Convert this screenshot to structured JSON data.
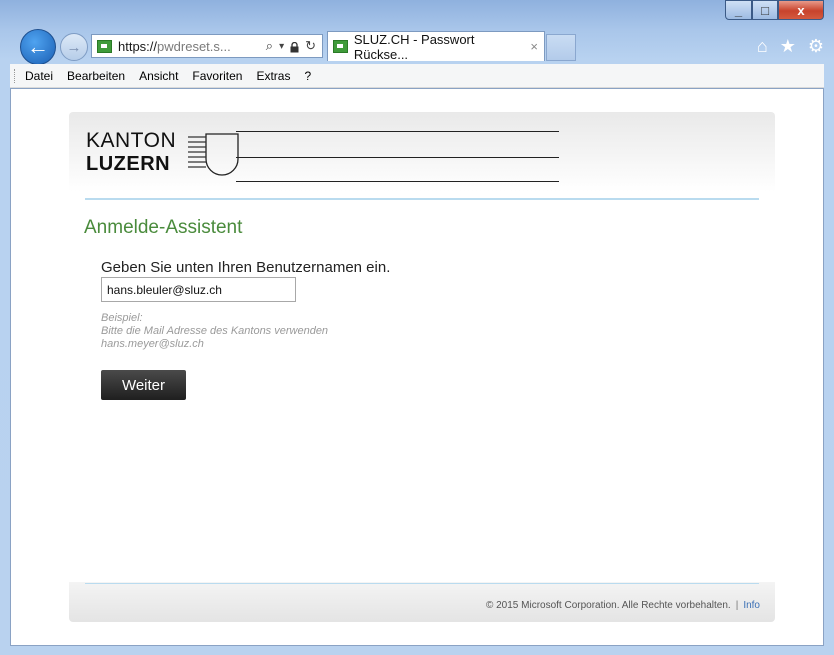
{
  "window": {
    "controls": {
      "minimize": "_",
      "maximize": "□",
      "close": "x"
    }
  },
  "nav": {
    "back_glyph": "←",
    "forward_glyph": "→",
    "address": {
      "scheme": "https://",
      "host": "pwdreset.s..."
    },
    "address_icons": {
      "search": "⌕",
      "dropdown": "▾",
      "lock": "🔒",
      "refresh": "↻"
    },
    "tab": {
      "title": "SLUZ.CH - Passwort Rückse...",
      "close": "×"
    },
    "right_icons": {
      "home": "⌂",
      "favorites": "★",
      "tools": "⚙"
    }
  },
  "menu": {
    "items": [
      "Datei",
      "Bearbeiten",
      "Ansicht",
      "Favoriten",
      "Extras",
      "?"
    ]
  },
  "page": {
    "logo": {
      "line1": "KANTON",
      "line2": "LUZERN"
    },
    "wizard_title": "Anmelde-Assistent",
    "prompt": "Geben Sie unten Ihren Benutzernamen ein.",
    "username_value": "hans.bleuler@sluz.ch",
    "hint": {
      "line1": "Beispiel:",
      "line2": "Bitte die Mail Adresse des Kantons verwenden",
      "line3": "hans.meyer@sluz.ch"
    },
    "next_button": "Weiter",
    "footer": {
      "copyright": "© 2015 Microsoft Corporation. Alle Rechte vorbehalten.",
      "separator": "|",
      "info": "Info"
    }
  },
  "colors": {
    "accent_green": "#4a8b3c",
    "link_blue": "#3a6fb5",
    "rule_blue": "#b9dbef"
  }
}
